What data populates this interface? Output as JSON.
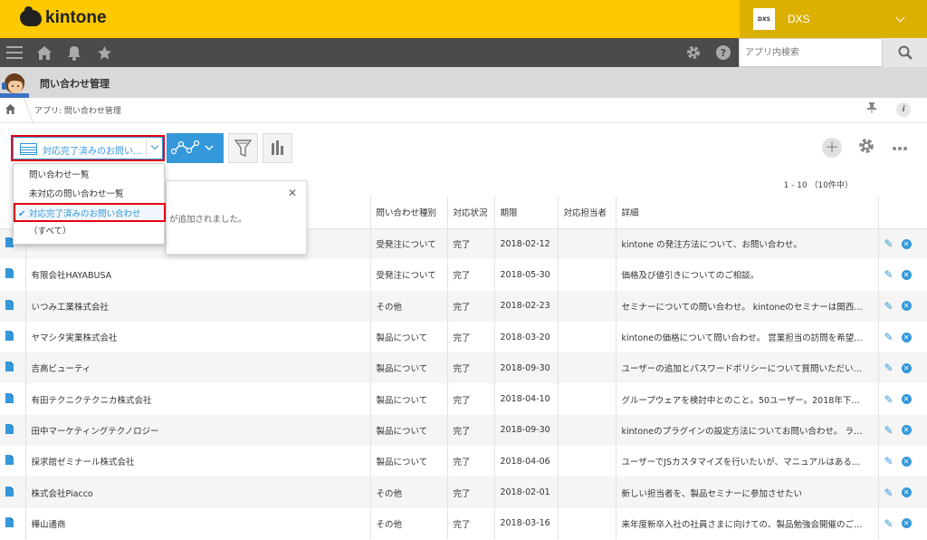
{
  "header": {
    "logo_text": "kintone",
    "space_logo_text": "DXS",
    "space_name": "DXS"
  },
  "nav": {
    "search_placeholder": "アプリ内検索"
  },
  "app": {
    "title": "問い合わせ管理",
    "breadcrumb": "アプリ: 問い合わせ管理"
  },
  "view": {
    "selected_label": "対応完了済みのお問い…"
  },
  "dropdown": {
    "items": [
      "問い合わせ一覧",
      "未対応の問い合わせ一覧",
      "対応完了済みのお問い合わせ",
      "（すべて）"
    ],
    "selected_index": 2
  },
  "popup": {
    "text": "が追加されました。"
  },
  "pager": {
    "text": "1 - 10 （10件中）"
  },
  "table": {
    "columns": [
      "",
      "",
      "問い合わせ種別",
      "対応状況",
      "期限",
      "対応担当者",
      "詳細",
      ""
    ],
    "rows": [
      {
        "company": "",
        "type": "受発注について",
        "status": "完了",
        "due": "2018-02-12",
        "assignee": "",
        "detail": "kintone の発注方法について、お問い合わせ。"
      },
      {
        "company": "有限会社HAYABUSA",
        "type": "受発注について",
        "status": "完了",
        "due": "2018-05-30",
        "assignee": "",
        "detail": "価格及び値引きについてのご相談。"
      },
      {
        "company": "いつみ工業株式会社",
        "type": "その他",
        "status": "完了",
        "due": "2018-02-23",
        "assignee": "",
        "detail": "セミナーについての問い合わせ。 kintoneのセミナーは関西…"
      },
      {
        "company": "ヤマシタ実業株式会社",
        "type": "製品について",
        "status": "完了",
        "due": "2018-03-20",
        "assignee": "",
        "detail": "kintoneの価格について問い合わせ。 営業担当の訪問を希望…"
      },
      {
        "company": "吉高ビューティ",
        "type": "製品について",
        "status": "完了",
        "due": "2018-09-30",
        "assignee": "",
        "detail": "ユーザーの追加とパスワードポリシーについて質問いただい…"
      },
      {
        "company": "有田テクニクテクニカ株式会社",
        "type": "製品について",
        "status": "完了",
        "due": "2018-04-10",
        "assignee": "",
        "detail": "グループウェアを検討中とのこと。50ユーザー。2018年下…"
      },
      {
        "company": "田中マーケティングテクノロジー",
        "type": "製品について",
        "status": "完了",
        "due": "2018-09-30",
        "assignee": "",
        "detail": "kintoneのプラグインの設定方法についてお問い合わせ。 ラ…"
      },
      {
        "company": "採求館ゼミナール株式会社",
        "type": "製品について",
        "status": "完了",
        "due": "2018-04-06",
        "assignee": "",
        "detail": "ユーザーでJSカスタマイズを行いたいが、マニュアルはある…"
      },
      {
        "company": "株式会社Piacco",
        "type": "その他",
        "status": "完了",
        "due": "2018-02-01",
        "assignee": "",
        "detail": "新しい担当者を、製品セミナーに参加させたい"
      },
      {
        "company": "樺山通商",
        "type": "その他",
        "status": "完了",
        "due": "2018-03-16",
        "assignee": "",
        "detail": "来年度新卒入社の社員さまに向けての、製品勉強会開催のご…"
      }
    ]
  },
  "colors": {
    "brand_yellow": "#fec900",
    "accent_blue": "#3498db",
    "highlight_red": "#e60012"
  }
}
